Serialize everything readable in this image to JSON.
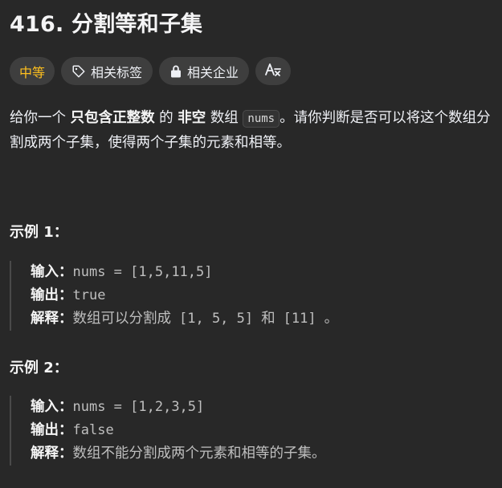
{
  "problem": {
    "title": "416. 分割等和子集"
  },
  "tags": {
    "difficulty": "中等",
    "topics": "相关标签",
    "companies": "相关企业"
  },
  "description": {
    "p1": "给你一个",
    "b1": "只包含正整数",
    "p2": "的",
    "b2": "非空",
    "p3": "数组",
    "code": "nums",
    "p4": "。请你判断是否可以将这个数组分割成两个子集，使得两个子集的元素和相等。"
  },
  "examples": [
    {
      "title": "示例 1：",
      "input_label": "输入：",
      "input_value": "nums = [1,5,11,5]",
      "output_label": "输出：",
      "output_value": "true",
      "explain_label": "解释：",
      "explain_text1": "数组可以分割成",
      "explain_code1": "[1, 5, 5]",
      "explain_text2": "和",
      "explain_code2": "[11]",
      "explain_text3": "。"
    },
    {
      "title": "示例 2：",
      "input_label": "输入：",
      "input_value": "nums = [1,2,3,5]",
      "output_label": "输出：",
      "output_value": "false",
      "explain_label": "解释：",
      "explain_text1": "数组不能分割成两个元素和相等的子集。"
    }
  ],
  "colors": {
    "background": "#282828",
    "difficulty_medium": "#ffc01e",
    "tag_background": "#3e3e3e"
  },
  "icons": {
    "topics": "tag-icon",
    "companies": "lock-icon",
    "translate": "translate-icon"
  }
}
